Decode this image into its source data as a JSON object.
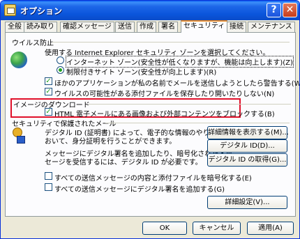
{
  "window": {
    "title": "オプション",
    "help_label": "?",
    "close_label": "✕"
  },
  "tabs": [
    {
      "label": "全般"
    },
    {
      "label": "読み取り"
    },
    {
      "label": "確認メッセージ"
    },
    {
      "label": "送信"
    },
    {
      "label": "作成"
    },
    {
      "label": "署名"
    },
    {
      "label": "セキュリティ",
      "active": true
    },
    {
      "label": "接続"
    },
    {
      "label": "メンテナンス"
    }
  ],
  "virus": {
    "heading": "ウイルス防止",
    "description": "使用する Internet Explorer セキュリティ ゾーンを選択してください。",
    "zone_internet": "インターネット ゾーン(安全性が低くなりますが、機能は向上します)(Z)",
    "zone_restricted": "制限付きサイト ゾーン(安全性が向上します)(R)",
    "warn_send": "ほかのアプリケーションが私の名前でメールを送信しようとしたら警告する(W)",
    "no_attach": "ウイルスの可能性がある添付ファイルを保存したり開いたりしない(N)"
  },
  "images": {
    "heading": "イメージのダウンロード",
    "block_label": "HTML 電子メールにある画像および外部コンテンツをブロックする(B)"
  },
  "secure": {
    "heading": "セキュリティで保護されたメール",
    "id_desc_1": "デジタル ID (証明書) によって、電子的な情報のやりとりに",
    "id_desc_2": "おいて、身分証明を行うことができます。",
    "sign_desc_1": "メッセージにデジタル署名を追加したり、暗号化されたメッ",
    "sign_desc_2": "セージを受信するには、デジタル ID が必要です。",
    "more_info_btn": "詳細情報を表示する(M)...",
    "digital_id_btn": "デジタル ID(D)...",
    "get_id_btn": "デジタル ID の取得(G)...",
    "encrypt_all": "すべての送信メッセージの内容と添付ファイルを暗号化する(E)",
    "sign_all": "すべての送信メッセージにデジタル署名を追加する(G)",
    "advanced_btn": "詳細設定(V)..."
  },
  "footer": {
    "ok": "OK",
    "cancel": "キャンセル",
    "apply": "適用(A)"
  },
  "colors": {
    "titlebar": "#0A55DB",
    "face": "#ECE9D8",
    "highlight": "#E0102A",
    "check": "#21A121"
  }
}
